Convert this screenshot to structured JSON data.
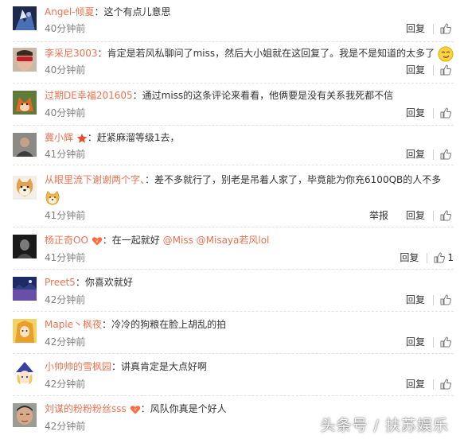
{
  "comments": [
    {
      "username": "Angel-倾夏",
      "text": "这个有点儿意思",
      "time": "40分钟前",
      "reply": "回复",
      "avatar": "blue-anime-avatar"
    },
    {
      "username": "李采尼3003",
      "text": "肯定是若风私聊问了miss，然后大小姐就在这回复了。我是不是知道的太多了",
      "time": "40分钟前",
      "reply": "回复",
      "avatar": "red-sunglasses-avatar",
      "emoji": "smirk-emoji"
    },
    {
      "username": "过期DE幸福201605",
      "text": "通过miss的这条评论来看看，他俩要是没有关系我死都不信",
      "time": "40分钟前",
      "reply": "回复",
      "avatar": "fox-avatar"
    },
    {
      "username": "冀小辉",
      "text": "赶紧麻溜等级1去，",
      "time": "41分钟前",
      "reply": "回复",
      "avatar": "person-avatar",
      "badge": "star-badge-icon"
    },
    {
      "username": "从眼里流下谢谢两个字、",
      "text": "差不多就行了，别老是吊着人家了，毕竟能为你充6100QB的人不多",
      "time": "41分钟前",
      "report": "举报",
      "reply": "回复",
      "avatar": "shiba-dog-avatar",
      "emoji": "doge-emoji"
    },
    {
      "username": "杨正奇OO",
      "text_before": "在一起就好",
      "mention1": "@Miss",
      "mention2": "@Misaya若风lol",
      "time": "41分钟前",
      "reply": "回复",
      "like_count": "1",
      "avatar": "dark-portrait-avatar",
      "badge": "heart-badge-icon"
    },
    {
      "username": "Preet5",
      "text": "你喜欢就好",
      "time": "42分钟前",
      "reply": "回复",
      "avatar": "landscape-avatar"
    },
    {
      "username": "Maple丶枫夜",
      "text": "冷冷的狗粮在脸上胡乱的拍",
      "time": "42分钟前",
      "reply": "回复",
      "avatar": "yellow-anime-avatar"
    },
    {
      "username": "小帅帅的雪枫园",
      "text": "讲真肯定是大点好啊",
      "time": "42分钟前",
      "reply": "回复",
      "avatar": "witch-hat-avatar"
    },
    {
      "username": "刘谋的粉粉粉丝sss",
      "text": "风队你真是个好人",
      "time": "42分钟前",
      "reply": "回复",
      "avatar": "man-face-avatar",
      "badge": "heart-badge-icon"
    }
  ],
  "watermark": "头条号 / 扶苏娱乐",
  "colors": {
    "username": "#eb7350",
    "text": "#333333",
    "time": "#808080",
    "divider": "#e2e2e2"
  }
}
